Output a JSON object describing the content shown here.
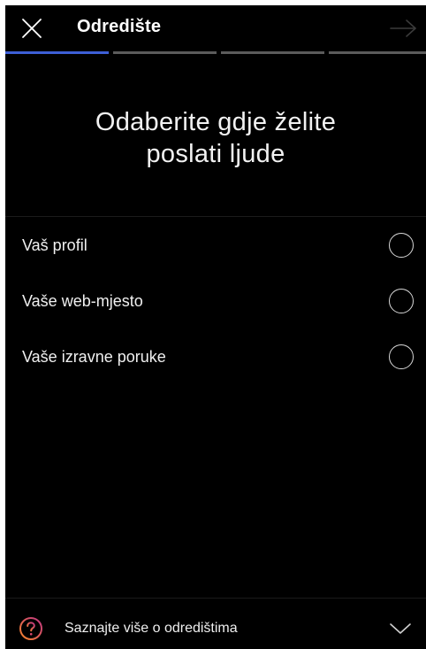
{
  "header": {
    "title": "Odredište",
    "close_icon": "close-icon",
    "next_icon": "arrow-right-icon"
  },
  "progress": {
    "total_steps": 4,
    "current_step": 1
  },
  "headline": {
    "line1": "Odaberite gdje želite",
    "line2": "poslati ljude"
  },
  "options": [
    {
      "label": "Vaš profil",
      "selected": false
    },
    {
      "label": "Vaše web-mjesto",
      "selected": false
    },
    {
      "label": "Vaše izravne poruke",
      "selected": false
    }
  ],
  "footer": {
    "label": "Saznajte više o odredištima",
    "help_icon": "question-circle-icon",
    "chevron_icon": "chevron-down-icon"
  },
  "colors": {
    "background": "#000000",
    "accent": "#3d5fd6",
    "help_gradient_start": "#f58529",
    "help_gradient_end": "#c13584"
  }
}
